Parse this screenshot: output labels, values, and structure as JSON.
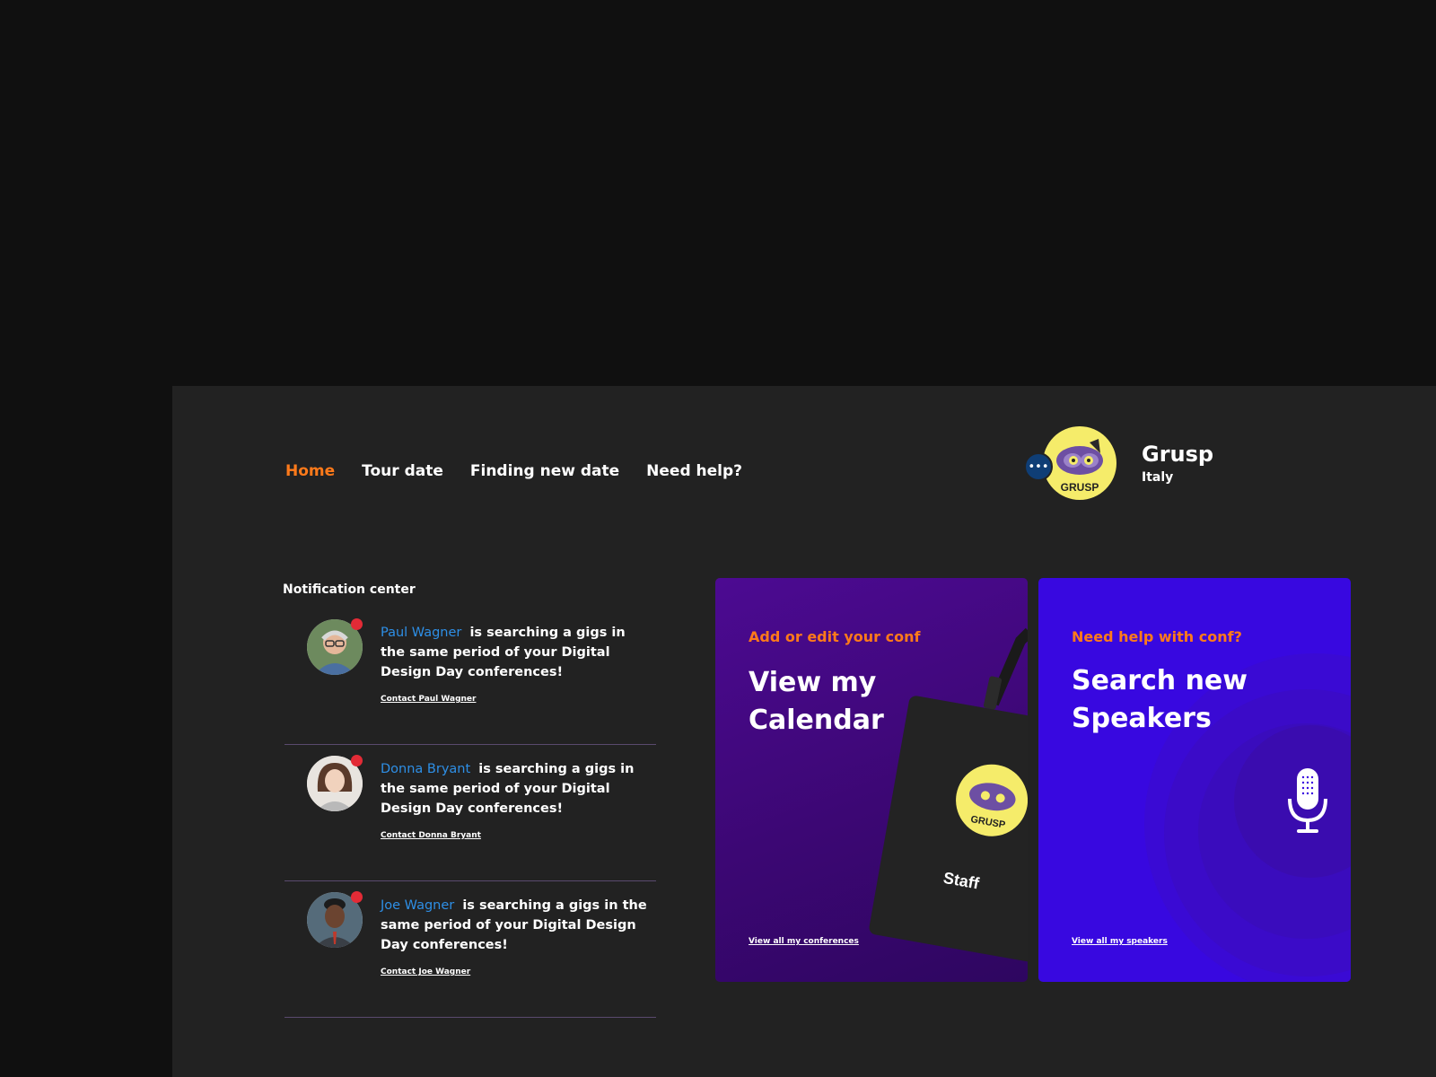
{
  "nav": {
    "items": [
      {
        "label": "Home",
        "active": true
      },
      {
        "label": "Tour date",
        "active": false
      },
      {
        "label": "Finding new date",
        "active": false
      },
      {
        "label": "Need help?",
        "active": false
      }
    ]
  },
  "profile": {
    "name": "Grusp",
    "country": "Italy",
    "logo_text": "GRUSP",
    "more_icon": "ellipsis-icon"
  },
  "notifications": {
    "title": "Notification center",
    "items": [
      {
        "name": "Paul Wagner",
        "message": "is searching a gigs in the same period of your Digital Design Day conferences!",
        "link": "Contact Paul Wagner"
      },
      {
        "name": "Donna Bryant",
        "message": "is searching a gigs in the same period of your Digital Design Day conferences!",
        "link": "Contact Donna Bryant"
      },
      {
        "name": "Joe Wagner",
        "message": "is searching a gigs in the same period of your Digital Design Day conferences!",
        "link": "Contact Joe Wagner"
      }
    ]
  },
  "cards": {
    "conferences": {
      "kicker": "Add or edit your conf",
      "title": "View my Calendar",
      "link": "View all my conferences",
      "badge_text": "Staff"
    },
    "speakers": {
      "kicker": "Need help with conf?",
      "title": "Search new Speakers",
      "link": "View all my speakers"
    }
  },
  "colors": {
    "accent": "#ff7a1a",
    "name_link": "#2e8fe6",
    "notification_dot": "#e32b36",
    "card_conf": "#4c0a92",
    "card_speakers": "#3808e0"
  }
}
